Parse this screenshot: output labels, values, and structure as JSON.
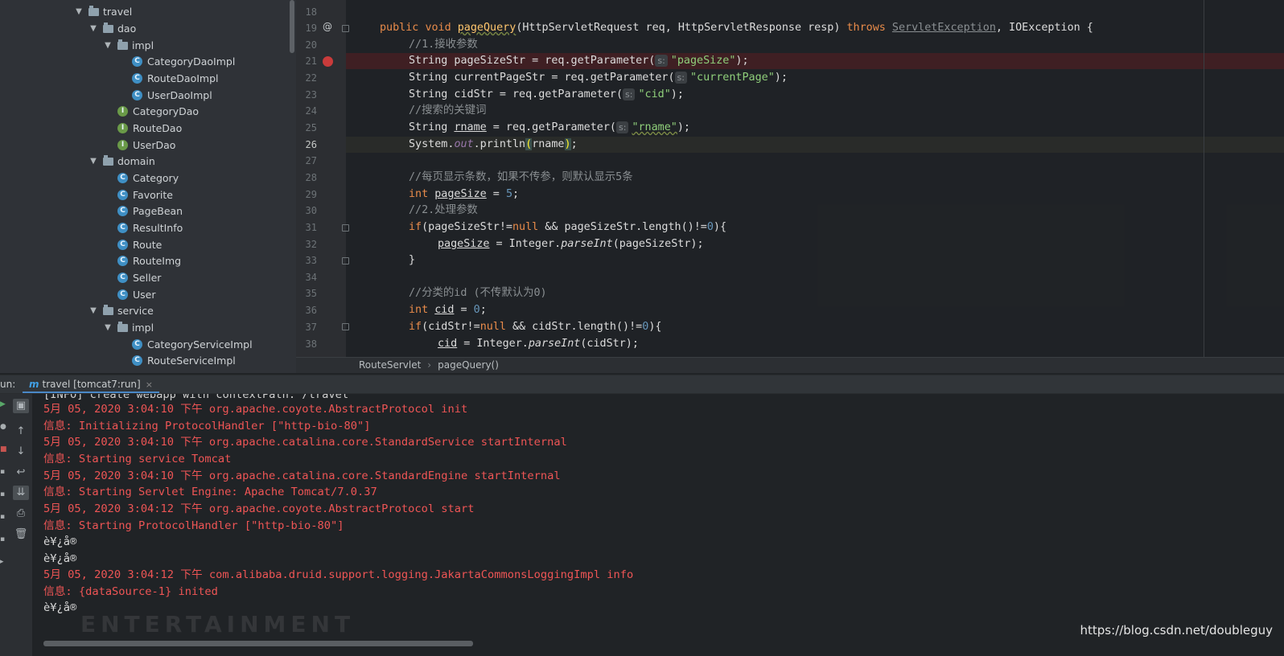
{
  "project_tree": [
    {
      "label": "travel",
      "kind": "package",
      "arrow": "▼"
    },
    {
      "label": "dao",
      "kind": "package",
      "arrow": "▼"
    },
    {
      "label": "impl",
      "kind": "package",
      "arrow": "▼"
    },
    {
      "label": "CategoryDaoImpl",
      "kind": "class"
    },
    {
      "label": "RouteDaoImpl",
      "kind": "class"
    },
    {
      "label": "UserDaoImpl",
      "kind": "class"
    },
    {
      "label": "CategoryDao",
      "kind": "interface"
    },
    {
      "label": "RouteDao",
      "kind": "interface"
    },
    {
      "label": "UserDao",
      "kind": "interface"
    },
    {
      "label": "domain",
      "kind": "package",
      "arrow": "▼"
    },
    {
      "label": "Category",
      "kind": "class"
    },
    {
      "label": "Favorite",
      "kind": "class"
    },
    {
      "label": "PageBean",
      "kind": "class"
    },
    {
      "label": "ResultInfo",
      "kind": "class"
    },
    {
      "label": "Route",
      "kind": "class"
    },
    {
      "label": "RouteImg",
      "kind": "class"
    },
    {
      "label": "Seller",
      "kind": "class"
    },
    {
      "label": "User",
      "kind": "class"
    },
    {
      "label": "service",
      "kind": "package",
      "arrow": "▼"
    },
    {
      "label": "impl",
      "kind": "package",
      "arrow": "▼"
    },
    {
      "label": "CategoryServiceImpl",
      "kind": "class"
    },
    {
      "label": "RouteServiceImpl",
      "kind": "class"
    }
  ],
  "icons": {
    "class": "C",
    "interface": "I",
    "breakpoint": "breakpoint-icon",
    "override": "@"
  },
  "editor": {
    "line_numbers": [
      "18",
      "19",
      "20",
      "21",
      "22",
      "23",
      "24",
      "25",
      "26",
      "27",
      "28",
      "29",
      "30",
      "31",
      "32",
      "33",
      "34",
      "35",
      "36",
      "37",
      "38"
    ],
    "current_line": "26",
    "breakpoint_line": "21",
    "hint_label": "s:",
    "code": {
      "l19_public": "public",
      "l19_void": "void",
      "l19_name": "pageQuery",
      "l19_params": "(HttpServletRequest req, HttpServletResponse resp) ",
      "l19_throws": "throws",
      "l19_ex1": "ServletException",
      "l19_ex2": ", IOException {",
      "l20": "//1.接收参数",
      "l21_a": "String pageSizeStr = req.getParameter(",
      "l21_s": "\"pageSize\"",
      "l21_b": ");",
      "l22_a": "String currentPageStr = req.getParameter(",
      "l22_s": "\"currentPage\"",
      "l22_b": ");",
      "l23_a": "String cidStr = req.getParameter(",
      "l23_s": "\"cid\"",
      "l23_b": ");",
      "l24": "//搜索的关键词",
      "l25_a": "String ",
      "l25_var": "rname",
      "l25_b": " = req.getParameter(",
      "l25_s": "\"rname\"",
      "l25_c": ");",
      "l26_a": "System.",
      "l26_out": "out",
      "l26_b": ".println",
      "l26_p1": "(",
      "l26_var": "rname",
      "l26_p2": ")",
      "l26_c": ";",
      "l28": "//每页显示条数，如果不传参，则默认显示5条",
      "l29_int": "int",
      "l29_var": "pageSize",
      "l29_eq": " = ",
      "l29_num": "5",
      "l29_end": ";",
      "l30": "//2.处理参数",
      "l31_if": "if",
      "l31_a": "(pageSizeStr!=",
      "l31_null": "null",
      "l31_b": " && pageSizeStr.length()!=",
      "l31_zero": "0",
      "l31_c": "){",
      "l32_var": "pageSize",
      "l32_a": " = Integer.",
      "l32_m": "parseInt",
      "l32_b": "(pageSizeStr);",
      "l33": "}",
      "l35": "//分类的id (不传默认为0)",
      "l36_int": "int",
      "l36_var": "cid",
      "l36_eq": " = ",
      "l36_num": "0",
      "l36_end": ";",
      "l37_if": "if",
      "l37_a": "(cidStr!=",
      "l37_null": "null",
      "l37_b": " && cidStr.length()!=",
      "l37_zero": "0",
      "l37_c": "){",
      "l38_var": "cid",
      "l38_a": " = Integer.",
      "l38_m": "parseInt",
      "l38_b": "(cidStr);"
    }
  },
  "breadcrumb": {
    "class": "RouteServlet",
    "method": "pageQuery()",
    "separator": "›"
  },
  "run_panel": {
    "label": "un:",
    "tab_icon": "m",
    "tab_title": "travel [tomcat7:run]",
    "close": "×",
    "cut_line": "[INFO] create webapp with contextPath: /travel",
    "lines": [
      {
        "text": "5月 05, 2020 3:04:10 下午 org.apache.coyote.AbstractProtocol init",
        "style": "red"
      },
      {
        "text": "信息: Initializing ProtocolHandler [\"http-bio-80\"]",
        "style": "red"
      },
      {
        "text": "5月 05, 2020 3:04:10 下午 org.apache.catalina.core.StandardService startInternal",
        "style": "red"
      },
      {
        "text": "信息: Starting service Tomcat",
        "style": "red"
      },
      {
        "text": "5月 05, 2020 3:04:10 下午 org.apache.catalina.core.StandardEngine startInternal",
        "style": "red"
      },
      {
        "text": "信息: Starting Servlet Engine: Apache Tomcat/7.0.37",
        "style": "red"
      },
      {
        "text": "5月 05, 2020 3:04:12 下午 org.apache.coyote.AbstractProtocol start",
        "style": "red"
      },
      {
        "text": "信息: Starting ProtocolHandler [\"http-bio-80\"]",
        "style": "red"
      },
      {
        "text": "è¥¿å®",
        "style": "plain"
      },
      {
        "text": "è¥¿å®",
        "style": "plain"
      },
      {
        "text": "5月 05, 2020 3:04:12 下午 com.alibaba.druid.support.logging.JakartaCommonsLoggingImpl info",
        "style": "red"
      },
      {
        "text": "信息: {dataSource-1} inited",
        "style": "red"
      },
      {
        "text": "è¥¿å®",
        "style": "plain"
      }
    ]
  },
  "watermark": "https://blog.csdn.net/doubleguy",
  "background_logo": "ENTERTAINMENT",
  "colors": {
    "keyword": "#e88b4a",
    "string": "#8fcf7a",
    "comment": "#8a8f92",
    "console_red": "#ee5555",
    "breakpoint": "#c93b3b"
  }
}
